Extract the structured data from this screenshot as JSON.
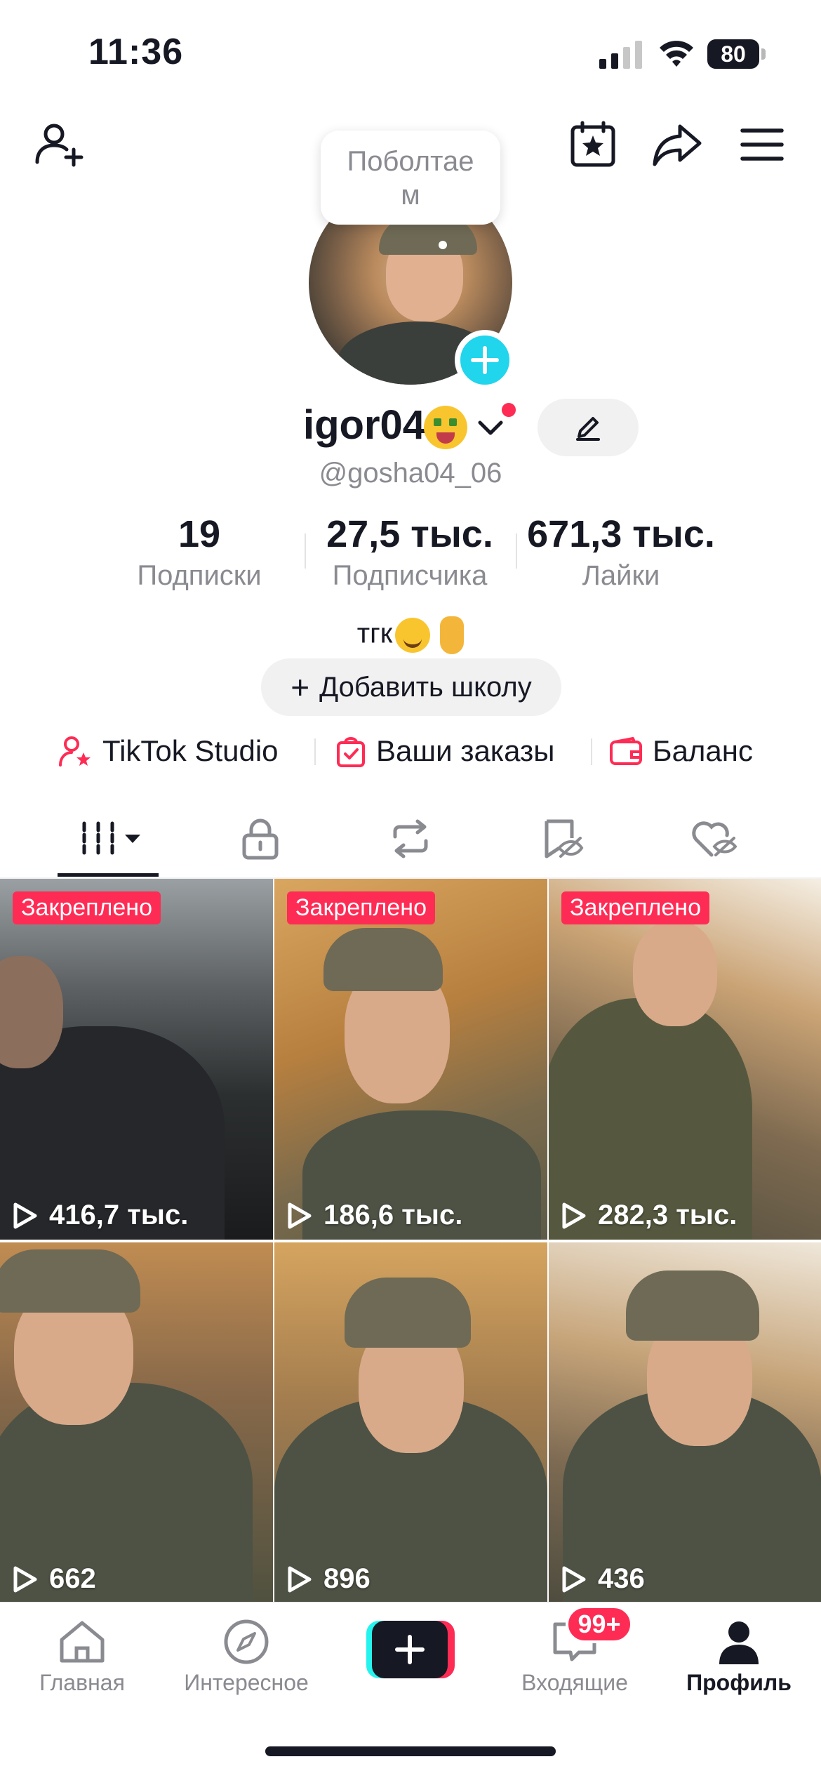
{
  "status_bar": {
    "time": "11:36",
    "battery": "80"
  },
  "profile": {
    "bubble_line1": "Поболтае",
    "bubble_line2": "м",
    "name": "igor04",
    "handle": "@gosha04_06",
    "edit_icon": "pencil-icon"
  },
  "stats": [
    {
      "number": "19",
      "label": "Подписки"
    },
    {
      "number": "27,5 тыс.",
      "label": "Подписчика"
    },
    {
      "number": "671,3 тыс.",
      "label": "Лайки"
    }
  ],
  "bio": {
    "text": "тгк"
  },
  "add_school": {
    "label": "Добавить школу"
  },
  "links": [
    {
      "label": "TikTok Studio",
      "icon": "studio-person-star-icon"
    },
    {
      "label": "Ваши заказы",
      "icon": "orders-bag-icon"
    },
    {
      "label": "Баланс",
      "icon": "wallet-icon"
    }
  ],
  "tabs": [
    {
      "icon": "grid-icon"
    },
    {
      "icon": "lock-icon"
    },
    {
      "icon": "repost-icon"
    },
    {
      "icon": "favorites-bookmark-icon"
    },
    {
      "icon": "liked-heart-icon"
    }
  ],
  "videos": [
    {
      "pinned": "Закреплено",
      "views": "416,7 тыс."
    },
    {
      "pinned": "Закреплено",
      "views": "186,6 тыс."
    },
    {
      "pinned": "Закреплено",
      "views": "282,3 тыс."
    },
    {
      "views": "662"
    },
    {
      "views": "896"
    },
    {
      "views": "436"
    }
  ],
  "bottom_nav": {
    "home": "Главная",
    "discover": "Интересное",
    "inbox": "Входящие",
    "inbox_badge": "99+",
    "profile": "Профиль"
  },
  "colors": {
    "accent": "#fe2c55",
    "cyan": "#20d5ec",
    "text": "#161823",
    "muted": "#8a8b91"
  }
}
